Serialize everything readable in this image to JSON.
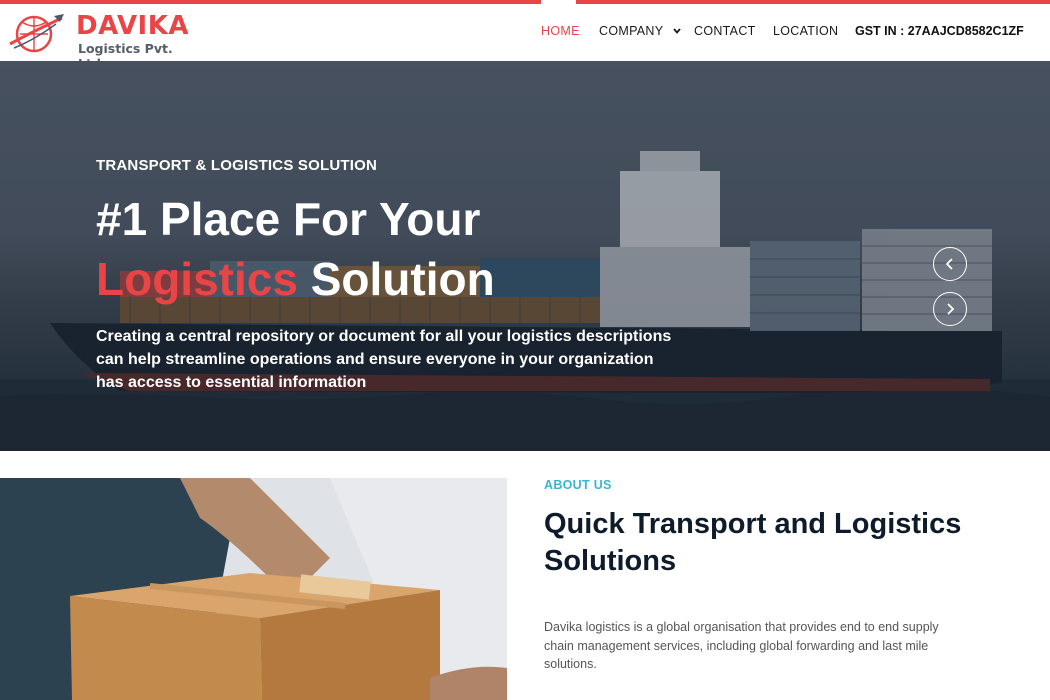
{
  "brand": {
    "name": "DAVIKA",
    "subtitle": "Logistics Pvt. Ltd",
    "accent_color": "#e94547"
  },
  "nav": {
    "items": [
      {
        "label": "HOME",
        "active": true
      },
      {
        "label": "COMPANY",
        "active": false,
        "has_dropdown": true
      },
      {
        "label": "CONTACT",
        "active": false
      },
      {
        "label": "LOCATION",
        "active": false
      }
    ],
    "gst": "GST IN : 27AAJCD8582C1ZF"
  },
  "hero": {
    "kicker": "TRANSPORT & LOGISTICS SOLUTION",
    "title_line1": "#1 Place For Your",
    "title_accent": "Logistics",
    "title_rest": "Solution",
    "description": "Creating a central repository or document for all your logistics descriptions can help streamline operations and ensure everyone in your organization has access to essential information",
    "prev_icon": "chevron-left-icon",
    "next_icon": "chevron-right-icon"
  },
  "about": {
    "kicker": "ABOUT US",
    "title": "Quick Transport and Logistics Solutions",
    "description": "Davika logistics is a global organisation that provides end to end supply chain management services, including global forwarding and last mile solutions.",
    "kicker_color": "#38b6d6"
  }
}
